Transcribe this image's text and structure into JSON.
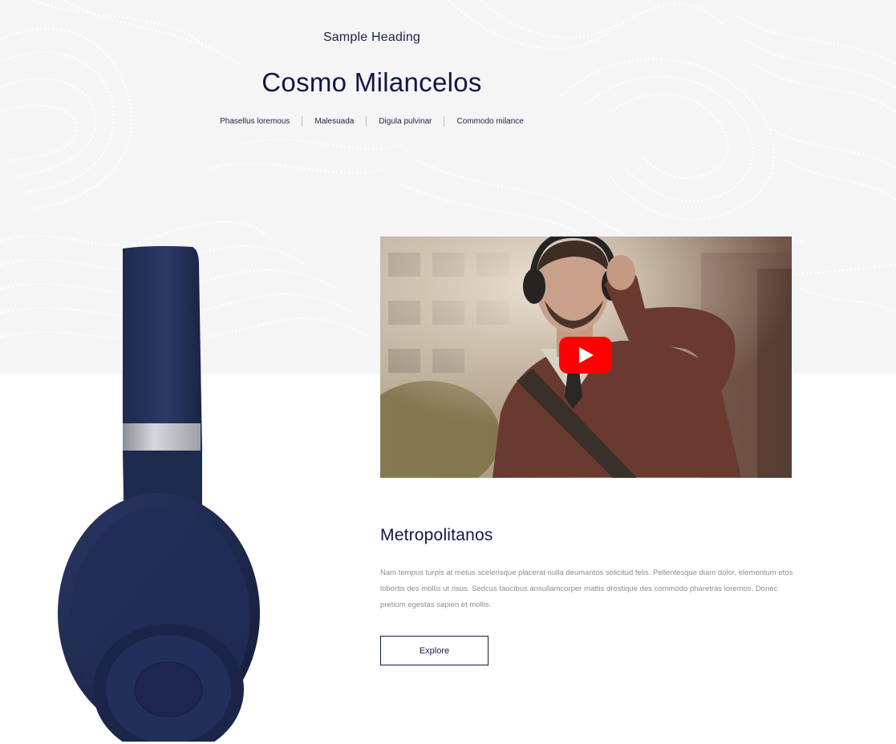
{
  "header": {
    "sample_heading": "Sample Heading",
    "title": "Cosmo Milancelos",
    "tabs": [
      {
        "label": "Phasellus loremous"
      },
      {
        "label": "Malesuada"
      },
      {
        "label": "Digula pulvinar"
      },
      {
        "label": "Commodo milance"
      }
    ]
  },
  "product": {
    "image_icon": "headphones-icon",
    "color": "#25325a"
  },
  "video": {
    "play_icon": "play-icon",
    "play_color": "#ff0000"
  },
  "content": {
    "title": "Metropolitanos",
    "body": "Nam tempus turpis at metus scelerisque placerat nulla deumantos solicitud felis. Pellentesque diam dolor, elementum etos lobortis des mollis ut risus. Sedcus faucibus ansullamcorper mattis drostique des commodo pharetras loremos. Donec pretium egestas sapien et mollis.",
    "button_label": "Explore"
  }
}
